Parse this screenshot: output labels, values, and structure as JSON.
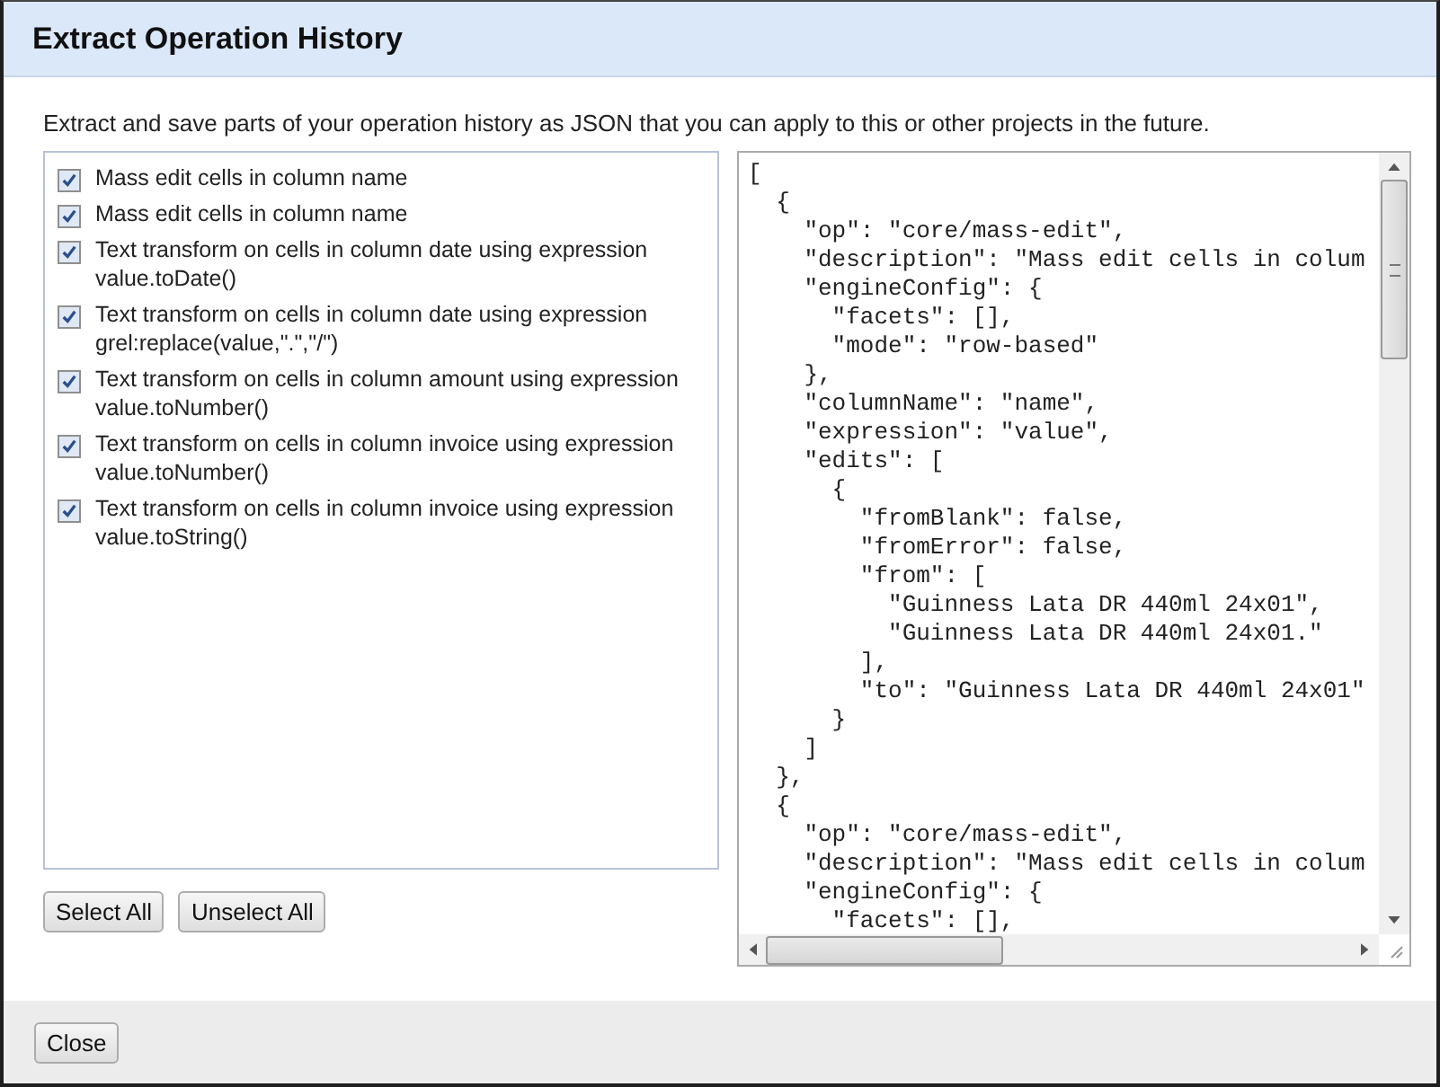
{
  "dialog": {
    "title": "Extract Operation History",
    "description": "Extract and save parts of your operation history as JSON that you can apply to this or other projects in the future."
  },
  "operations": [
    {
      "label": "Mass edit cells in column name",
      "checked": true
    },
    {
      "label": "Mass edit cells in column name",
      "checked": true
    },
    {
      "label": "Text transform on cells in column date using expression value.toDate()",
      "checked": true
    },
    {
      "label": "Text transform on cells in column date using expression grel:replace(value,\".\",\"/\")",
      "checked": true
    },
    {
      "label": "Text transform on cells in column amount using expression value.toNumber()",
      "checked": true
    },
    {
      "label": "Text transform on cells in column invoice using expression value.toNumber()",
      "checked": true
    },
    {
      "label": "Text transform on cells in column invoice using expression value.toString()",
      "checked": true
    }
  ],
  "selection_buttons": [
    "Select All",
    "Unselect All"
  ],
  "json_output": {
    "lines": [
      "[",
      "  {",
      "    \"op\": \"core/mass-edit\",",
      "    \"description\": \"Mass edit cells in colum",
      "    \"engineConfig\": {",
      "      \"facets\": [],",
      "      \"mode\": \"row-based\"",
      "    },",
      "    \"columnName\": \"name\",",
      "    \"expression\": \"value\",",
      "    \"edits\": [",
      "      {",
      "        \"fromBlank\": false,",
      "        \"fromError\": false,",
      "        \"from\": [",
      "          \"Guinness Lata DR 440ml 24x01\",",
      "          \"Guinness Lata DR 440ml 24x01.\"",
      "        ],",
      "        \"to\": \"Guinness Lata DR 440ml 24x01\"",
      "      }",
      "    ]",
      "  },",
      "  {",
      "    \"op\": \"core/mass-edit\",",
      "    \"description\": \"Mass edit cells in colum",
      "    \"engineConfig\": {",
      "      \"facets\": [],"
    ]
  },
  "footer": {
    "close_button": "Close"
  }
}
